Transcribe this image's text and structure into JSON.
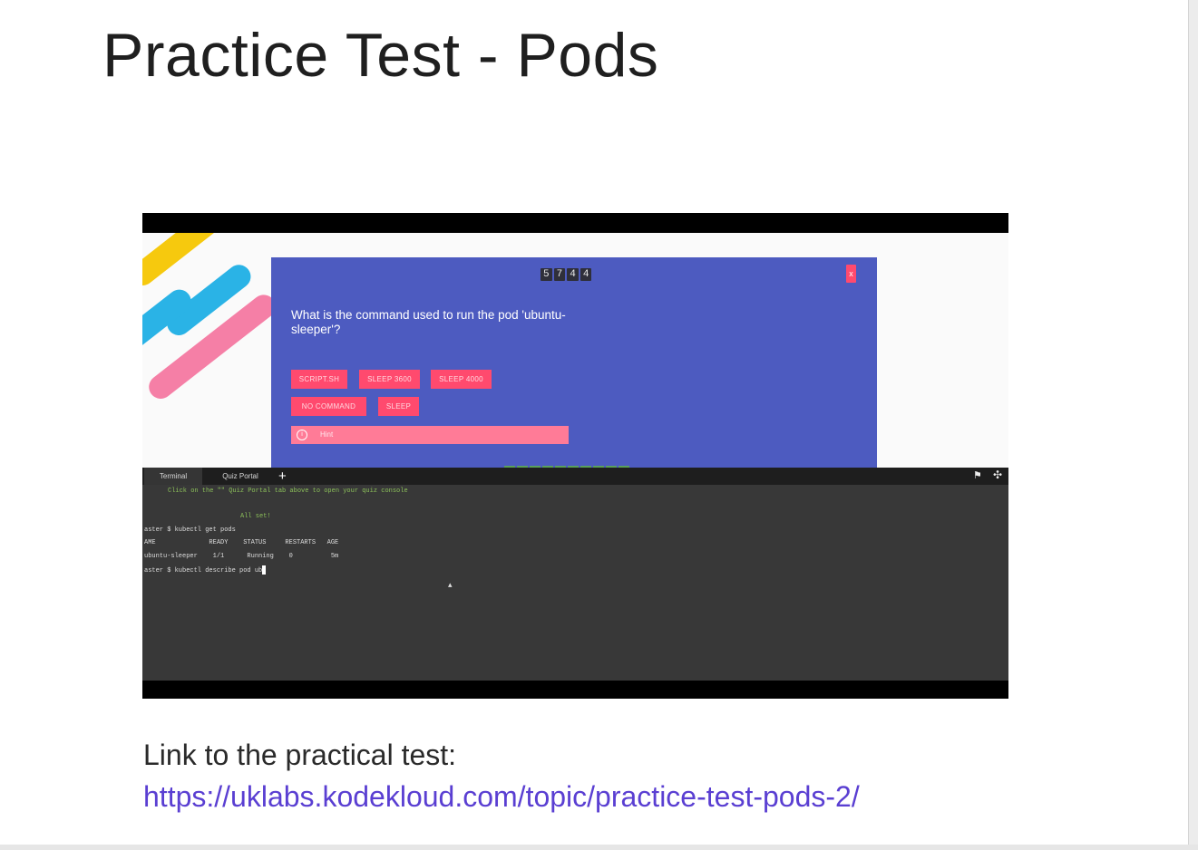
{
  "page": {
    "title": "Practice Test - Pods"
  },
  "quiz": {
    "timer": [
      "5",
      "7",
      "4",
      "4"
    ],
    "question": "What is the command used to run the pod 'ubuntu-sleeper'?",
    "options": [
      "SCRIPT.SH",
      "SLEEP 3600",
      "SLEEP 4000",
      "NO COMMAND",
      "SLEEP"
    ],
    "hint_label": "Hint",
    "progress": [
      "1",
      "2",
      "3",
      "4",
      "5",
      "6",
      "7",
      "8",
      "9",
      "10"
    ],
    "close_label": "x"
  },
  "terminal": {
    "tabs": [
      "Terminal",
      "Quiz Portal"
    ],
    "lines": [
      "Click on the \"\" Quiz Portal tab above to open your quiz console",
      "All set!",
      "aster $ kubectl get pods",
      "AME              READY    STATUS     RESTARTS   AGE",
      "ubuntu-sleeper    1/1      Running    0          5m",
      "aster $ kubectl describe pod ub"
    ]
  },
  "footer": {
    "label": "Link to the practical test:",
    "url": "https://uklabs.kodekloud.com/topic/practice-test-pods-2/"
  }
}
